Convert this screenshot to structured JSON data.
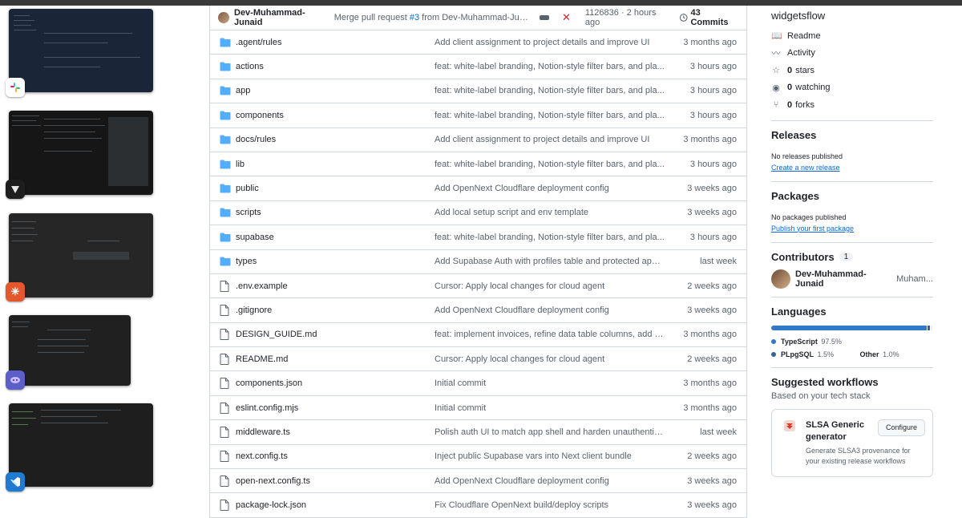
{
  "switcher": {
    "apps": [
      {
        "icon": "slack-icon",
        "color": "#ffffff"
      },
      {
        "icon": "cursor-icon",
        "color": "#1e1e1e"
      },
      {
        "icon": "claude-icon",
        "color": "#e4572e"
      },
      {
        "icon": "copilot-icon",
        "color": "#5b5fc7"
      },
      {
        "icon": "vscode-icon",
        "color": "#1f7bd1"
      }
    ]
  },
  "commit": {
    "author": "Dev-Muhammad-Junaid",
    "message_prefix": "Merge pull request ",
    "message_link": "#3",
    "message_suffix": " from Dev-Muhammad-Junaid/...",
    "sha": "1126836",
    "time": "· 2 hours ago",
    "commits_label": "43 Commits"
  },
  "files": [
    {
      "type": "dir",
      "name": ".agent/rules",
      "message": "Add client assignment to project details and improve UI",
      "age": "3 months ago"
    },
    {
      "type": "dir",
      "name": "actions",
      "message": "feat: white-label branding, Notion-style filter bars, and pla...",
      "age": "3 hours ago"
    },
    {
      "type": "dir",
      "name": "app",
      "message": "feat: white-label branding, Notion-style filter bars, and pla...",
      "age": "3 hours ago"
    },
    {
      "type": "dir",
      "name": "components",
      "message": "feat: white-label branding, Notion-style filter bars, and pla...",
      "age": "3 hours ago"
    },
    {
      "type": "dir",
      "name": "docs/rules",
      "message": "Add client assignment to project details and improve UI",
      "age": "3 months ago"
    },
    {
      "type": "dir",
      "name": "lib",
      "message": "feat: white-label branding, Notion-style filter bars, and pla...",
      "age": "3 hours ago"
    },
    {
      "type": "dir",
      "name": "public",
      "message": "Add OpenNext Cloudflare deployment config",
      "age": "3 weeks ago"
    },
    {
      "type": "dir",
      "name": "scripts",
      "message": "Add local setup script and env template",
      "age": "3 weeks ago"
    },
    {
      "type": "dir",
      "name": "supabase",
      "message": "feat: white-label branding, Notion-style filter bars, and pla...",
      "age": "3 hours ago"
    },
    {
      "type": "dir",
      "name": "types",
      "message": "Add Supabase Auth with profiles table and protected app r...",
      "age": "last week"
    },
    {
      "type": "file",
      "name": ".env.example",
      "message": "Cursor: Apply local changes for cloud agent",
      "age": "2 weeks ago"
    },
    {
      "type": "file",
      "name": ".gitignore",
      "message": "Add OpenNext Cloudflare deployment config",
      "age": "3 weeks ago"
    },
    {
      "type": "file",
      "name": "DESIGN_GUIDE.md",
      "message": "feat: implement invoices, refine data table columns, add d...",
      "age": "3 months ago"
    },
    {
      "type": "file",
      "name": "README.md",
      "message": "Cursor: Apply local changes for cloud agent",
      "age": "2 weeks ago"
    },
    {
      "type": "file",
      "name": "components.json",
      "message": "Initial commit",
      "age": "3 months ago"
    },
    {
      "type": "file",
      "name": "eslint.config.mjs",
      "message": "Initial commit",
      "age": "3 months ago"
    },
    {
      "type": "file",
      "name": "middleware.ts",
      "message": "Polish auth UI to match app shell and harden unauthentica...",
      "age": "last week"
    },
    {
      "type": "file",
      "name": "next.config.ts",
      "message": "Inject public Supabase vars into Next client bundle",
      "age": "2 weeks ago"
    },
    {
      "type": "file",
      "name": "open-next.config.ts",
      "message": "Add OpenNext Cloudflare deployment config",
      "age": "3 weeks ago"
    },
    {
      "type": "file",
      "name": "package-lock.json",
      "message": "Fix Cloudflare OpenNext build/deploy scripts",
      "age": "3 weeks ago"
    }
  ],
  "sidebar": {
    "repo_name": "widgetsflow",
    "meta": [
      {
        "icon": "book-icon",
        "strong": "",
        "label": "Readme"
      },
      {
        "icon": "pulse-icon",
        "strong": "",
        "label": "Activity"
      },
      {
        "icon": "star-icon",
        "strong": "0",
        "label": "stars"
      },
      {
        "icon": "eye-icon",
        "strong": "0",
        "label": "watching"
      },
      {
        "icon": "fork-icon",
        "strong": "0",
        "label": "forks"
      }
    ],
    "releases": {
      "title": "Releases",
      "text": "No releases published",
      "link": "Create a new release"
    },
    "packages": {
      "title": "Packages",
      "text": "No packages published",
      "link": "Publish your first package"
    },
    "contributors": {
      "title": "Contributors",
      "count": "1",
      "name": "Dev-Muhammad-Junaid",
      "extra": "Muham..."
    },
    "languages": {
      "title": "Languages",
      "items": [
        {
          "name": "TypeScript",
          "pct": "97.5%",
          "value": 97.5,
          "color": "#3178c6"
        },
        {
          "name": "PLpgSQL",
          "pct": "1.5%",
          "value": 1.5,
          "color": "#336790"
        },
        {
          "name": "Other",
          "pct": "1.0%",
          "value": 1.0,
          "color": "#ededed"
        }
      ]
    },
    "workflows": {
      "title": "Suggested workflows",
      "subtitle": "Based on your tech stack",
      "card_title": "SLSA Generic generator",
      "card_desc": "Generate SLSA3 provenance for your existing release workflows",
      "button": "Configure"
    }
  }
}
